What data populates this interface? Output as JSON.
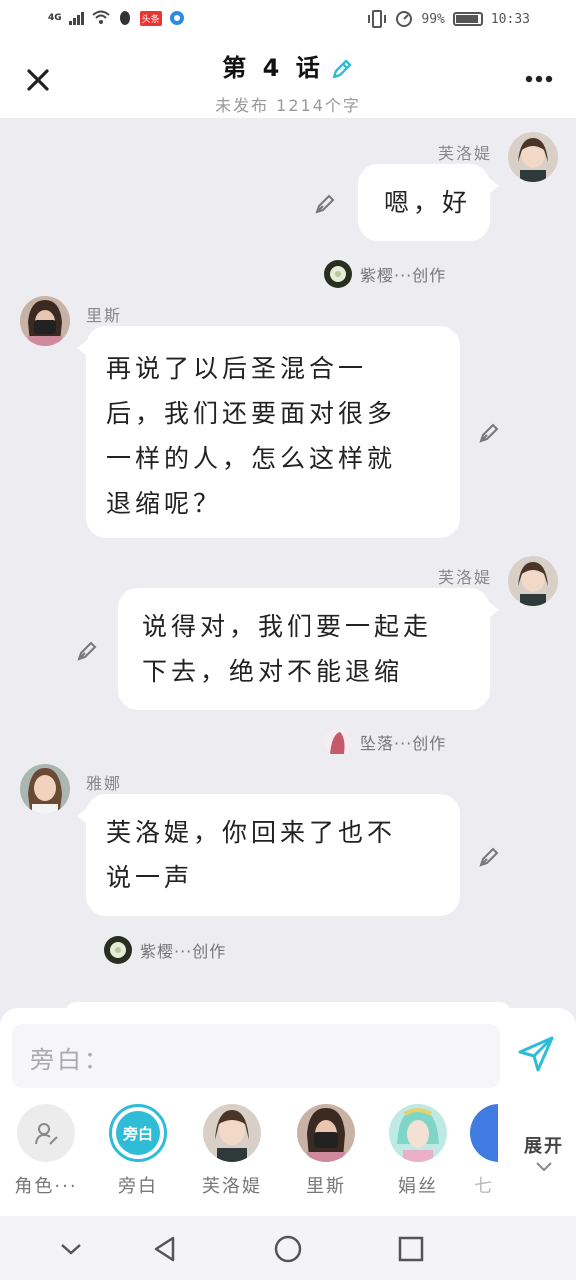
{
  "status_bar": {
    "network": "4G",
    "battery": "99%",
    "time": "10:33",
    "app_badge": "头条"
  },
  "header": {
    "title": "第 4 话",
    "subtitle": "未发布 1214个字"
  },
  "messages": [
    {
      "speaker": "芙洛媞",
      "text": "嗯，好",
      "side": "right",
      "author": "紫樱···创作"
    },
    {
      "speaker": "里斯",
      "text_lines": [
        "再说了以后圣混合一",
        "后，我们还要面对很多",
        "一样的人，怎么这样就",
        "退缩呢？"
      ],
      "side": "left"
    },
    {
      "speaker": "芙洛媞",
      "text_lines": [
        "说得对，我们要一起走",
        "下去，绝对不能退缩"
      ],
      "side": "right",
      "author": "坠落···创作"
    },
    {
      "speaker": "雅娜",
      "text_lines": [
        "芙洛媞，你回来了也不",
        "说一声"
      ],
      "side": "left",
      "author": "紫樱···创作"
    }
  ],
  "input": {
    "placeholder": "旁白："
  },
  "roles": [
    {
      "label": "角色···"
    },
    {
      "label": "旁白",
      "avatar_text": "旁白"
    },
    {
      "label": "芙洛媞"
    },
    {
      "label": "里斯"
    },
    {
      "label": "娟丝"
    },
    {
      "label": "七"
    }
  ],
  "expand_label": "展开",
  "colors": {
    "accent": "#2fbcd6",
    "background": "#ececf1",
    "bubble": "#ffffff"
  }
}
